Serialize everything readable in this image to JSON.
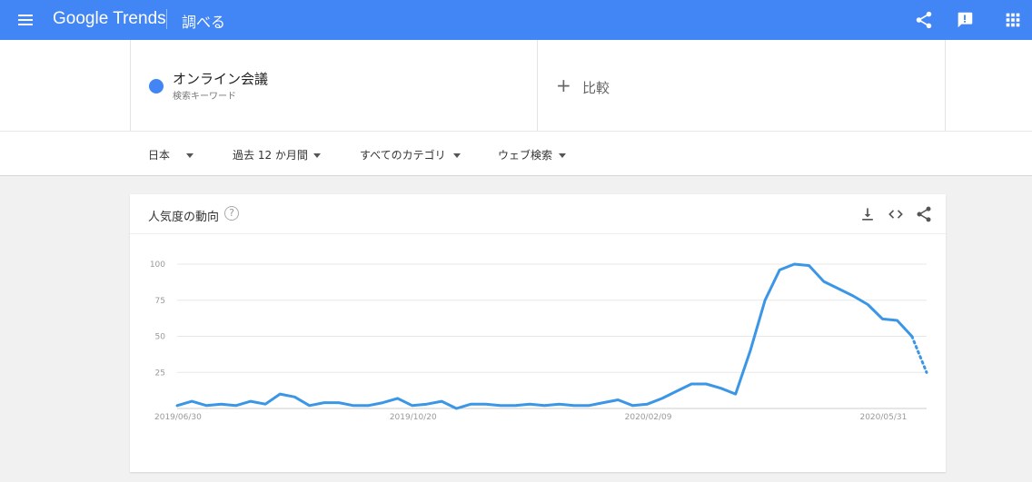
{
  "topbar": {
    "logo": "Google Trends",
    "section": "調べる",
    "icons": [
      "menu-icon",
      "share-icon",
      "feedback-icon",
      "apps-icon"
    ]
  },
  "term": {
    "name": "オンライン会議",
    "subtitle": "検索キーワード",
    "color": "#4285f4"
  },
  "compare": {
    "label": "比較"
  },
  "filters": {
    "region": "日本",
    "period": "過去 12 か月間",
    "category": "すべてのカテゴリ",
    "search_type": "ウェブ検索"
  },
  "card": {
    "title": "人気度の動向",
    "icons": [
      "help-icon",
      "download-icon",
      "embed-icon",
      "share-icon"
    ]
  },
  "chart_data": {
    "type": "line",
    "title": "",
    "xlabel": "",
    "ylabel": "",
    "ylim": [
      0,
      100
    ],
    "y_ticks": [
      25,
      50,
      75,
      100
    ],
    "x_tick_labels": [
      "2019/06/30",
      "2019/10/20",
      "2020/02/09",
      "2020/05/31"
    ],
    "x_tick_index": [
      0,
      16,
      32,
      48
    ],
    "grid": true,
    "series": [
      {
        "color": "#3b96e6",
        "values": [
          2,
          5,
          2,
          3,
          2,
          5,
          3,
          10,
          8,
          2,
          4,
          4,
          2,
          2,
          4,
          7,
          2,
          3,
          5,
          0,
          3,
          3,
          2,
          2,
          3,
          2,
          3,
          2,
          2,
          4,
          6,
          2,
          3,
          7,
          12,
          17,
          17,
          14,
          10,
          40,
          75,
          96,
          100,
          99,
          88,
          83,
          78,
          72,
          62,
          61,
          50,
          25
        ],
        "partial_from_index": 50
      }
    ]
  }
}
